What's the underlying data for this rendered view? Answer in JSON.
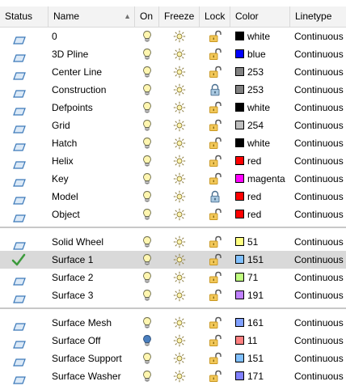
{
  "columns": {
    "status": "Status",
    "name": "Name",
    "on": "On",
    "freeze": "Freeze",
    "lock": "Lock",
    "color": "Color",
    "linetype": "Linetype"
  },
  "groups": [
    {
      "rows": [
        {
          "name": "0",
          "status": "layer",
          "on": "on",
          "freeze": "thawed",
          "lock": "unlocked",
          "color_label": "white",
          "color_hex": "#000000",
          "linetype": "Continuous"
        },
        {
          "name": "3D Pline",
          "status": "layer",
          "on": "on",
          "freeze": "thawed",
          "lock": "unlocked",
          "color_label": "blue",
          "color_hex": "#0000ff",
          "linetype": "Continuous"
        },
        {
          "name": "Center Line",
          "status": "layer",
          "on": "on",
          "freeze": "thawed",
          "lock": "unlocked",
          "color_label": "253",
          "color_hex": "#828282",
          "linetype": "Continuous"
        },
        {
          "name": "Construction",
          "status": "layer",
          "on": "on",
          "freeze": "thawed",
          "lock": "locked",
          "color_label": "253",
          "color_hex": "#828282",
          "linetype": "Continuous"
        },
        {
          "name": "Defpoints",
          "status": "layer",
          "on": "on",
          "freeze": "thawed",
          "lock": "unlocked",
          "color_label": "white",
          "color_hex": "#000000",
          "linetype": "Continuous"
        },
        {
          "name": "Grid",
          "status": "layer",
          "on": "on",
          "freeze": "thawed",
          "lock": "unlocked",
          "color_label": "254",
          "color_hex": "#bebebe",
          "linetype": "Continuous"
        },
        {
          "name": "Hatch",
          "status": "layer",
          "on": "on",
          "freeze": "thawed",
          "lock": "unlocked",
          "color_label": "white",
          "color_hex": "#000000",
          "linetype": "Continuous"
        },
        {
          "name": "Helix",
          "status": "layer",
          "on": "on",
          "freeze": "thawed",
          "lock": "unlocked",
          "color_label": "red",
          "color_hex": "#ff0000",
          "linetype": "Continuous"
        },
        {
          "name": "Key",
          "status": "layer",
          "on": "on",
          "freeze": "thawed",
          "lock": "unlocked",
          "color_label": "magenta",
          "color_hex": "#ff00ff",
          "linetype": "Continuous"
        },
        {
          "name": "Model",
          "status": "layer",
          "on": "on",
          "freeze": "thawed",
          "lock": "locked",
          "color_label": "red",
          "color_hex": "#ff0000",
          "linetype": "Continuous"
        },
        {
          "name": "Object",
          "status": "layer",
          "on": "on",
          "freeze": "thawed",
          "lock": "unlocked",
          "color_label": "red",
          "color_hex": "#ff0000",
          "linetype": "Continuous"
        }
      ]
    },
    {
      "rows": [
        {
          "name": "Solid Wheel",
          "status": "layer",
          "on": "on",
          "freeze": "thawed",
          "lock": "unlocked",
          "color_label": "51",
          "color_hex": "#ffff80",
          "linetype": "Continuous"
        },
        {
          "name": "Surface 1",
          "status": "current",
          "on": "on",
          "freeze": "thawed",
          "lock": "unlocked",
          "color_label": "151",
          "color_hex": "#80c0ff",
          "linetype": "Continuous",
          "selected": true
        },
        {
          "name": "Surface 2",
          "status": "layer",
          "on": "on",
          "freeze": "thawed",
          "lock": "unlocked",
          "color_label": "71",
          "color_hex": "#c0ff80",
          "linetype": "Continuous"
        },
        {
          "name": "Surface 3",
          "status": "layer",
          "on": "on",
          "freeze": "thawed",
          "lock": "unlocked",
          "color_label": "191",
          "color_hex": "#c080ff",
          "linetype": "Continuous"
        }
      ]
    },
    {
      "rows": [
        {
          "name": "Surface Mesh",
          "status": "layer",
          "on": "on",
          "freeze": "thawed",
          "lock": "unlocked",
          "color_label": "161",
          "color_hex": "#80a0ff",
          "linetype": "Continuous"
        },
        {
          "name": "Surface Off",
          "status": "layer",
          "on": "off",
          "freeze": "thawed",
          "lock": "unlocked",
          "color_label": "11",
          "color_hex": "#ff8080",
          "linetype": "Continuous"
        },
        {
          "name": "Surface Support",
          "status": "layer",
          "on": "on",
          "freeze": "thawed",
          "lock": "unlocked",
          "color_label": "151",
          "color_hex": "#80c0ff",
          "linetype": "Continuous"
        },
        {
          "name": "Surface Washer",
          "status": "layer",
          "on": "on",
          "freeze": "thawed",
          "lock": "unlocked",
          "color_label": "171",
          "color_hex": "#8080ff",
          "linetype": "Continuous"
        }
      ]
    }
  ],
  "icons": {
    "layer": "layer-status-icon",
    "current": "current-layer-checkmark-icon",
    "on": "lightbulb-on-icon",
    "off": "lightbulb-off-icon",
    "thawed": "sun-thawed-icon",
    "unlocked": "padlock-unlocked-icon",
    "locked": "padlock-locked-icon"
  },
  "colors": {
    "header_bg": "#f3f3f3",
    "selected_row": "#d9d9d9",
    "status_icon": "#3a78b8",
    "check_green": "#3c9a3c",
    "lock_gold": "#c8961e"
  }
}
